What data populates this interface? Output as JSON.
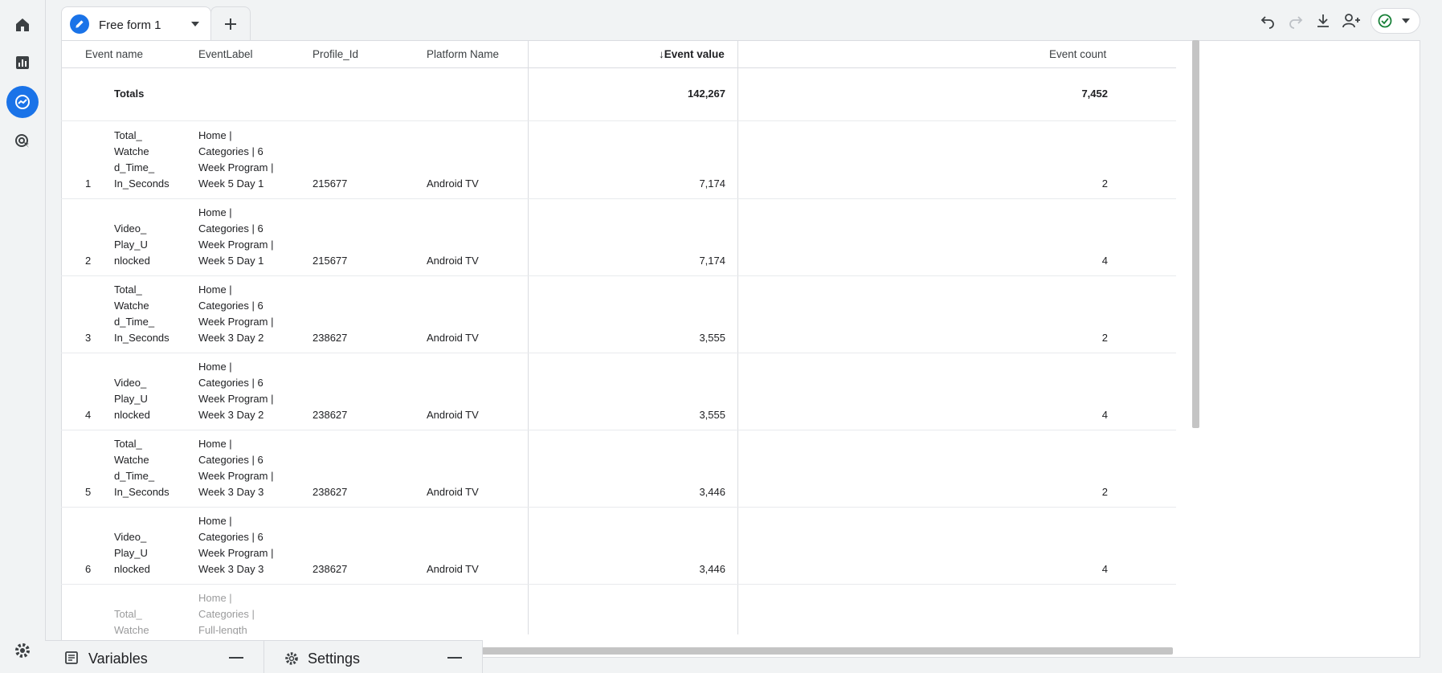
{
  "tab": {
    "title": "Free form 1"
  },
  "table": {
    "headers": {
      "event_name": "Event name",
      "event_label": "EventLabel",
      "profile_id": "Profile_Id",
      "platform": "Platform Name",
      "event_value": "Event value",
      "event_count": "Event count"
    },
    "sort_icon": "↓",
    "totals": {
      "label": "Totals",
      "event_value": "142,267",
      "event_count": "7,452"
    },
    "rows": [
      {
        "index": "1",
        "name": [
          "Total_",
          "Watche",
          "d_Time_",
          "In_Seconds"
        ],
        "label": [
          "Home |",
          "Categories | 6",
          "Week Program |",
          "Week 5 Day 1"
        ],
        "profile": "215677",
        "platform": "Android TV",
        "value": "7,174",
        "count": "2"
      },
      {
        "index": "2",
        "name": [
          "Video_",
          "Play_U",
          "nlocked"
        ],
        "label": [
          "Home |",
          "Categories | 6",
          "Week Program |",
          "Week 5 Day 1"
        ],
        "profile": "215677",
        "platform": "Android TV",
        "value": "7,174",
        "count": "4"
      },
      {
        "index": "3",
        "name": [
          "Total_",
          "Watche",
          "d_Time_",
          "In_Seconds"
        ],
        "label": [
          "Home |",
          "Categories | 6",
          "Week Program |",
          "Week 3 Day 2"
        ],
        "profile": "238627",
        "platform": "Android TV",
        "value": "3,555",
        "count": "2"
      },
      {
        "index": "4",
        "name": [
          "Video_",
          "Play_U",
          "nlocked"
        ],
        "label": [
          "Home |",
          "Categories | 6",
          "Week Program |",
          "Week 3 Day 2"
        ],
        "profile": "238627",
        "platform": "Android TV",
        "value": "3,555",
        "count": "4"
      },
      {
        "index": "5",
        "name": [
          "Total_",
          "Watche",
          "d_Time_",
          "In_Seconds"
        ],
        "label": [
          "Home |",
          "Categories | 6",
          "Week Program |",
          "Week 3 Day 3"
        ],
        "profile": "238627",
        "platform": "Android TV",
        "value": "3,446",
        "count": "2"
      },
      {
        "index": "6",
        "name": [
          "Video_",
          "Play_U",
          "nlocked"
        ],
        "label": [
          "Home |",
          "Categories | 6",
          "Week Program |",
          "Week 3 Day 3"
        ],
        "profile": "238627",
        "platform": "Android TV",
        "value": "3,446",
        "count": "4"
      }
    ],
    "partial_row": {
      "name": [
        "Total_",
        "Watche"
      ],
      "label": [
        "Home |",
        "Categories |",
        "Full-length"
      ]
    }
  },
  "panels": {
    "variables": "Variables",
    "settings": "Settings"
  }
}
